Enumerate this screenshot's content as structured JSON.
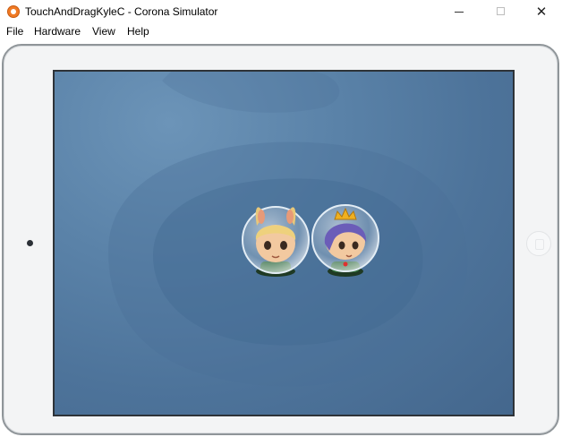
{
  "window": {
    "title": "TouchAndDragKyleC - Corona Simulator",
    "app_icon": "corona-app-icon",
    "controls": {
      "minimize": "—",
      "maximize": "☐",
      "close": "✕"
    }
  },
  "menu": {
    "items": [
      "File",
      "Hardware",
      "View",
      "Help"
    ]
  },
  "simulator": {
    "device": "iPad",
    "screen_background_color": "#4f769d",
    "characters": [
      {
        "name": "bunny-eared-astronaut",
        "hair_color": "#e8c87a",
        "ears_color": "#e79a78",
        "helmet": "glass-bubble"
      },
      {
        "name": "crowned-astronaut",
        "hair_color": "#6b5db8",
        "crown_color": "#f0b020",
        "helmet": "glass-bubble"
      }
    ]
  }
}
